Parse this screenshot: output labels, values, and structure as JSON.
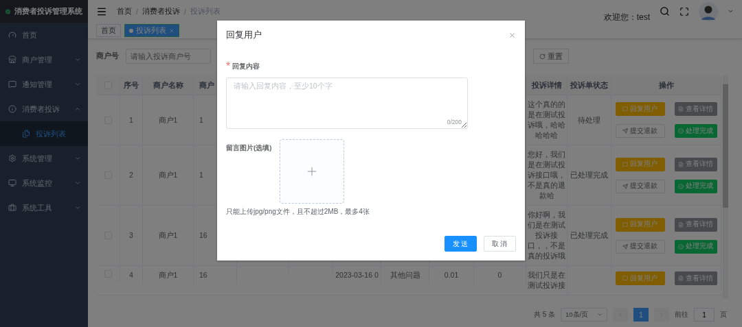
{
  "sidebar": {
    "logo_title": "消费者投诉管理系统",
    "items": [
      {
        "label": "首页",
        "selected": false
      },
      {
        "label": "商户管理",
        "selected": false,
        "expanded": false
      },
      {
        "label": "通知管理",
        "selected": false,
        "expanded": false
      },
      {
        "label": "消费者投诉",
        "selected": false,
        "expanded": true,
        "children": [
          {
            "label": "投诉列表",
            "selected": true
          }
        ]
      },
      {
        "label": "系统管理",
        "selected": false,
        "expanded": false
      },
      {
        "label": "系统监控",
        "selected": false,
        "expanded": false
      },
      {
        "label": "系统工具",
        "selected": false,
        "expanded": false
      }
    ]
  },
  "header": {
    "breadcrumb": [
      "首页",
      "消费者投诉",
      "投诉列表"
    ],
    "breadcrumb_separator": "/",
    "welcome": "欢迎您：test"
  },
  "tags": [
    {
      "label": "首页",
      "selected": false
    },
    {
      "label": "投诉列表",
      "selected": true
    }
  ],
  "filter": {
    "label": "商户号",
    "placeholder": "请输入投诉商户号",
    "reset": "重置"
  },
  "table": {
    "columns": [
      "序号",
      "商户名称",
      "商户",
      null,
      null,
      null,
      null,
      null,
      null,
      "投诉详情",
      "投诉单状态",
      "操作"
    ],
    "header_checked": false,
    "rows": [
      {
        "checked": false,
        "cells": [
          "1",
          "商户1",
          "1",
          null,
          null,
          null,
          null,
          null,
          null,
          "这个真的的是在测试投诉哦，哈哈哈哈哈",
          "待处理"
        ],
        "actions": [
          {
            "kind": "reply",
            "label": "回复用户"
          },
          {
            "kind": "detail",
            "label": "查看详情"
          },
          {
            "kind": "refund",
            "label": "提交退款"
          },
          {
            "kind": "done",
            "label": "处理完成"
          }
        ]
      },
      {
        "checked": false,
        "cells": [
          "2",
          "商户1",
          "1",
          null,
          null,
          null,
          null,
          null,
          null,
          "您好，我们是在测试投诉接口哦，不是真的退款哈",
          "已处理完成"
        ],
        "actions": [
          {
            "kind": "reply",
            "label": "回复用户"
          },
          {
            "kind": "detail",
            "label": "查看详情"
          },
          {
            "kind": "refund",
            "label": "提交退款"
          },
          {
            "kind": "done",
            "label": "处理完成"
          }
        ]
      },
      {
        "checked": false,
        "cells": [
          "3",
          "商户1",
          "16",
          null,
          null,
          null,
          null,
          null,
          null,
          "你好啊，我们是在测试投诉接口，，不是真的投诉哦",
          "已处理完成"
        ],
        "actions": [
          {
            "kind": "reply",
            "label": "回复用户"
          },
          {
            "kind": "detail",
            "label": "查看详情"
          },
          {
            "kind": "refund",
            "label": "提交退款"
          },
          {
            "kind": "done",
            "label": "处理完成"
          }
        ]
      },
      {
        "checked": false,
        "cells": [
          "4",
          "商户1",
          "16",
          null,
          null,
          "2023-03-16 0",
          "其他问题",
          "0.01",
          "0",
          "我们只是在测试投诉接",
          null
        ],
        "actions": [
          {
            "kind": "reply",
            "label": "回复用户"
          },
          {
            "kind": "detail",
            "label": "查看详情"
          }
        ]
      }
    ]
  },
  "pagination": {
    "total": "共 5 条",
    "page_size": "10条/页",
    "pages": [
      {
        "label": "1",
        "selected": true
      }
    ],
    "goto_label": "前往",
    "goto_value": "1",
    "goto_suffix": "页"
  },
  "dialog": {
    "title": "回复用户",
    "content_label": "回复内容",
    "content_required_mark": "*",
    "content_placeholder": "请输入回复内容，至少10个字",
    "counter": "0/200",
    "image_label": "留言图片(选填)",
    "image_hint": "只能上传jpg/png文件，且不超过2MB，最多4张",
    "buttons": [
      {
        "kind": "primary",
        "label": "发送"
      },
      {
        "kind": "default",
        "label": "取消"
      }
    ]
  }
}
